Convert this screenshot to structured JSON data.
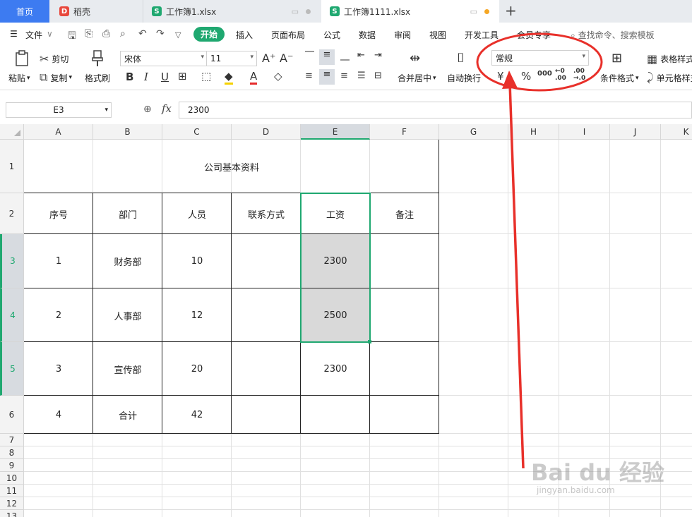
{
  "tabs": {
    "home": "首页",
    "daoke": "稻壳",
    "workbook1": "工作簿1.xlsx",
    "active": "工作簿1111.xlsx"
  },
  "menu": {
    "file": "文件",
    "start": "开始",
    "insert": "插入",
    "page_layout": "页面布局",
    "formula": "公式",
    "data": "数据",
    "review": "审阅",
    "view": "视图",
    "dev_tools": "开发工具",
    "member": "会员专享",
    "search_placeholder": "查找命令、搜索模板"
  },
  "ribbon": {
    "paste": "粘贴",
    "cut": "剪切",
    "copy": "复制",
    "format_painter": "格式刷",
    "font_name": "宋体",
    "font_size": "11",
    "merge_center": "合并居中",
    "wrap_text": "自动换行",
    "number_format": "常规",
    "currency_symbol": "¥",
    "percent_symbol": "%",
    "thousands": "000",
    "inc_decimal_top": "←0",
    "inc_decimal_bottom": ".00",
    "dec_decimal_top": ".00",
    "dec_decimal_bottom": "→.0",
    "conditional_format": "条件格式",
    "table_style": "表格样式",
    "cell_style": "单元格样式"
  },
  "formula_bar": {
    "name_box": "E3",
    "fx": "fx",
    "value": "2300"
  },
  "columns": [
    "A",
    "B",
    "C",
    "D",
    "E",
    "F",
    "G",
    "H",
    "I",
    "J",
    "K"
  ],
  "rows": [
    "1",
    "2",
    "3",
    "4",
    "5",
    "6",
    "7",
    "8",
    "9",
    "10",
    "11",
    "12",
    "13"
  ],
  "sheet": {
    "title": "公司基本资料",
    "headers": [
      "序号",
      "部门",
      "人员",
      "联系方式",
      "工资",
      "备注"
    ],
    "data": [
      [
        "1",
        "财务部",
        "10",
        "",
        "2300",
        ""
      ],
      [
        "2",
        "人事部",
        "12",
        "",
        "2500",
        ""
      ],
      [
        "3",
        "宣传部",
        "20",
        "",
        "2300",
        ""
      ],
      [
        "4",
        "合计",
        "42",
        "",
        "",
        ""
      ]
    ]
  },
  "watermark": {
    "brand": "Bai du 经验",
    "site": "jingyan.baidu.com"
  },
  "colors": {
    "accent": "#1fa870",
    "home_tab": "#3d7bf1",
    "annotation": "#e8302a"
  }
}
